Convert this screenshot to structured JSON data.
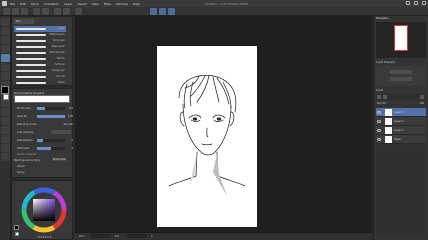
{
  "app": {
    "window_title": "Untitled - CLIP STUDIO PAINT"
  },
  "menubar": {
    "items": [
      "File",
      "Edit",
      "Story",
      "Animation",
      "Layer",
      "Select",
      "View",
      "Filter",
      "Window",
      "Help"
    ]
  },
  "subtool_panel": {
    "tab_label": "Pen",
    "brushes": [
      {
        "name": "G-pen",
        "selected": true
      },
      {
        "name": "Mapping pen",
        "selected": false
      },
      {
        "name": "Turnip pen",
        "selected": false
      },
      {
        "name": "Real G-pen",
        "selected": false
      },
      {
        "name": "Textured pen",
        "selected": false
      },
      {
        "name": "Marker",
        "selected": false
      },
      {
        "name": "Soft pen",
        "selected": false
      },
      {
        "name": "Rough pen",
        "selected": false
      },
      {
        "name": "Dry ink",
        "selected": false
      },
      {
        "name": "Brush",
        "selected": false
      },
      {
        "name": "Pencil",
        "selected": false
      }
    ]
  },
  "tool_property": {
    "title": "Tool property [G-pen]",
    "rows": [
      {
        "label": "Brush Size",
        "value": "5.0",
        "fill": 0.3
      },
      {
        "label": "Opacity",
        "value": "100",
        "fill": 1.0
      },
      {
        "label": "Blending mode",
        "value": "Normal",
        "fill": 0
      },
      {
        "label": "Anti-aliasing",
        "value": "",
        "fill": 0
      },
      {
        "label": "Stabilization",
        "value": "6",
        "fill": 0.2
      },
      {
        "label": "Hardness",
        "value": "4",
        "fill": 0.5
      }
    ],
    "footer_label": "Vector magnet",
    "extra": [
      {
        "label": "Starting and ending",
        "value": "Brush size"
      },
      {
        "label": "Vector",
        "value": ""
      },
      {
        "label": "Spray",
        "value": ""
      }
    ]
  },
  "color_wheel": {
    "main_color": "#000000",
    "sub_color": "#ffffff",
    "readout": "H 0 S 0 V 0"
  },
  "statusbar": {
    "zoom": "20.7",
    "angle": "0.0",
    "position": "0"
  },
  "navigator": {
    "title": "Navigator"
  },
  "layer_property": {
    "title": "Layer Property"
  },
  "layers": {
    "title": "Layer",
    "blend": "Normal",
    "opacity": "100",
    "items": [
      {
        "name": "Layer 3",
        "selected": true
      },
      {
        "name": "Layer 2",
        "selected": false
      },
      {
        "name": "Layer 1",
        "selected": false
      },
      {
        "name": "Paper",
        "selected": false
      }
    ]
  },
  "colors": {
    "accent": "#5570a6",
    "panel_bg": "#383838",
    "canvas_bg": "#1f1f1f"
  }
}
